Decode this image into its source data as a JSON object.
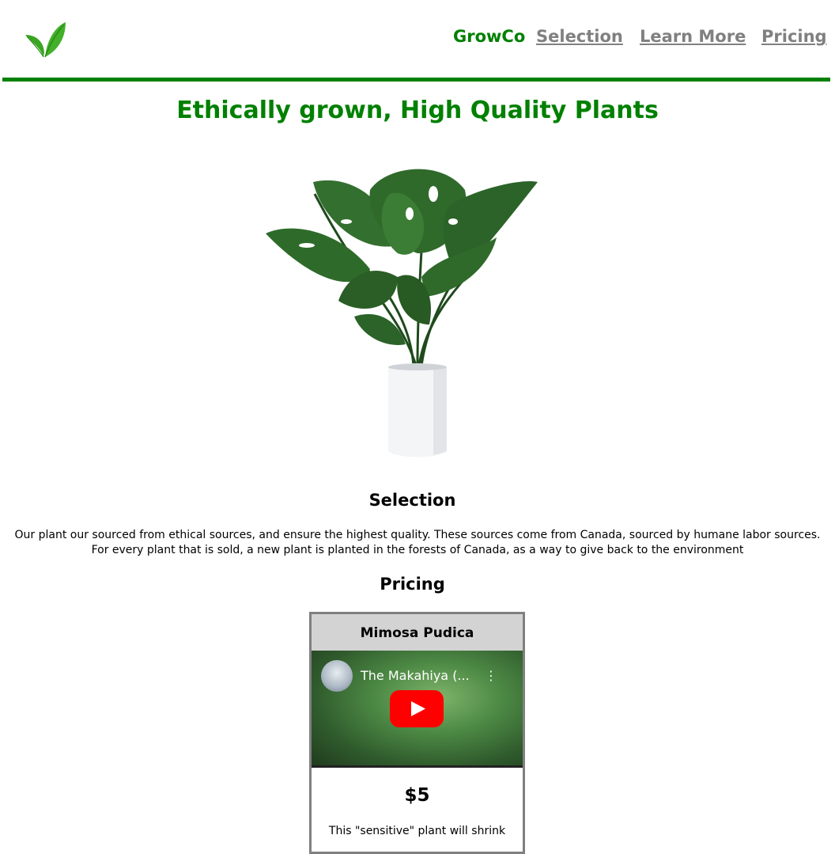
{
  "header": {
    "brand": "GrowCo",
    "nav": [
      "Selection",
      "Learn More",
      "Pricing"
    ],
    "accent_color": "#008000"
  },
  "hero": {
    "title": "Ethically grown, High Quality Plants",
    "image_icon": "potted-monstera-plant"
  },
  "selection": {
    "title": "Selection",
    "text_line1": "Our plant our sourced from ethical sources, and ensure the highest quality. These sources come from Canada, sourced by humane labor sources.",
    "text_line2": "For every plant that is sold, a new plant is planted in the forests of Canada, as a way to give back to the environment"
  },
  "pricing": {
    "title": "Pricing",
    "card": {
      "name": "Mimosa Pudica",
      "video_title": "The Makahiya (...",
      "price": "$5",
      "description": "This \"sensitive\" plant will shrink"
    }
  }
}
